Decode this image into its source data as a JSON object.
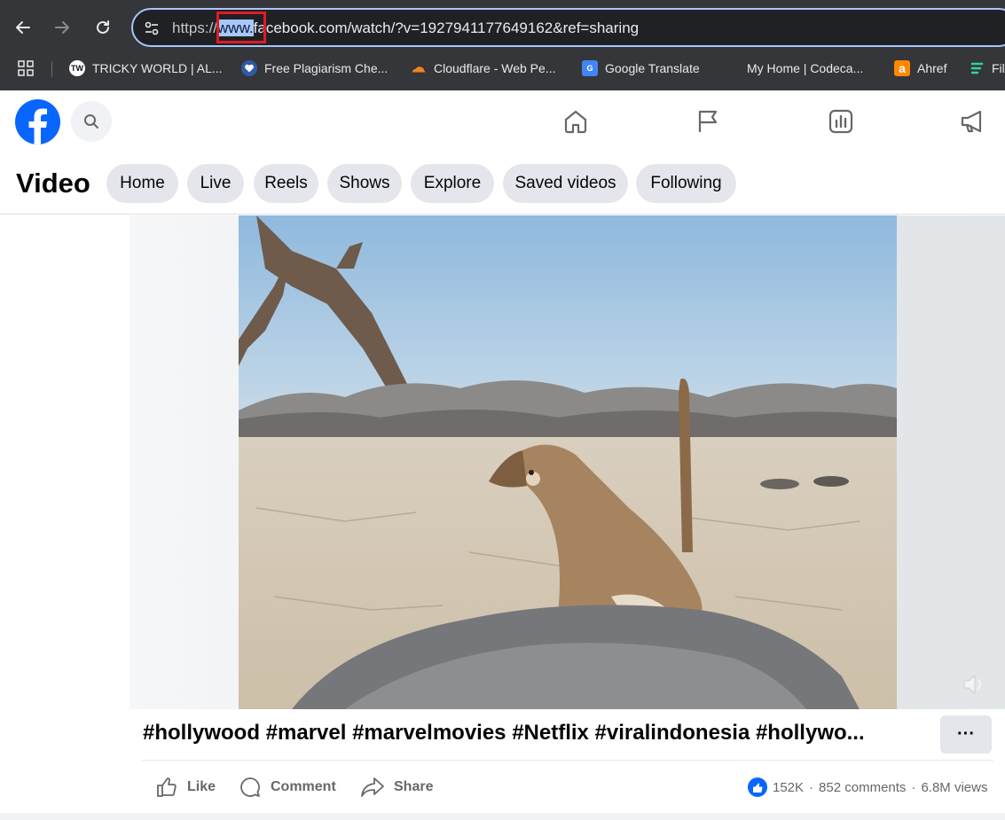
{
  "browser": {
    "back_icon": "arrow-left-icon",
    "forward_icon": "arrow-right-icon",
    "reload_icon": "reload-icon",
    "url_scheme": "https://",
    "url_selected": "www.",
    "url_rest": "facebook.com/watch/?v=1927941177649162&ref=sharing",
    "bookmarks": [
      {
        "label": "TRICKY WORLD | AL...",
        "icon": "tw-icon",
        "icon_text": "TW"
      },
      {
        "label": "Free Plagiarism Che...",
        "icon": "heart-icon",
        "icon_text": ""
      },
      {
        "label": "Cloudflare - Web Pe...",
        "icon": "cloudflare-icon",
        "icon_text": ""
      },
      {
        "label": "Google Translate",
        "icon": "google-translate-icon",
        "icon_text": "G"
      },
      {
        "label": "My Home | Codeca...",
        "icon": "codecademy-icon",
        "icon_text": ""
      },
      {
        "label": "Ahref",
        "icon": "ahrefs-icon",
        "icon_text": "a"
      },
      {
        "label": "Fil",
        "icon": "file-icon",
        "icon_text": ""
      }
    ]
  },
  "fb": {
    "brand_color": "#0866ff",
    "nav_icons": [
      "home-icon",
      "flag-icon",
      "dashboard-icon",
      "megaphone-icon"
    ]
  },
  "video_nav": {
    "title": "Video",
    "pills": [
      "Home",
      "Live",
      "Reels",
      "Shows",
      "Explore",
      "Saved videos",
      "Following"
    ]
  },
  "post": {
    "caption": "#hollywood #marvel #marvelmovies #Netflix #viralindonesia #hollywo...",
    "more_label": "···",
    "actions": {
      "like": "Like",
      "comment": "Comment",
      "share": "Share"
    },
    "stats": {
      "likes": "152K",
      "sep": "·",
      "comments": "852 comments",
      "views": "6.8M views"
    }
  }
}
